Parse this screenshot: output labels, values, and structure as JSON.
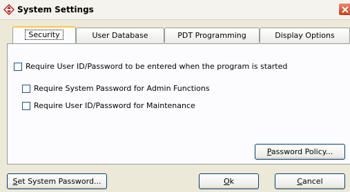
{
  "window": {
    "title": "System Settings",
    "app_icon": "diamond-arrows-icon",
    "close_icon": "close-x-icon",
    "accent_close": "#c4401c"
  },
  "tabs": [
    {
      "label": "Security",
      "active": true
    },
    {
      "label": "User Database",
      "active": false
    },
    {
      "label": "PDT Programming",
      "active": false
    },
    {
      "label": "Display Options",
      "active": false
    }
  ],
  "security": {
    "require_login": {
      "label": "Require User ID/Password to be entered when the program is started",
      "checked": false
    },
    "require_system_password": {
      "label": "Require System Password for Admin Functions",
      "checked": false
    },
    "require_maintenance_login": {
      "label": "Require User ID/Password for Maintenance",
      "checked": false
    },
    "password_policy_button": {
      "mnemonic": "P",
      "rest": "assword Policy..."
    }
  },
  "footer": {
    "set_password": {
      "mnemonic": "S",
      "rest": "et System Password..."
    },
    "ok": {
      "mnemonic": "O",
      "rest": "k"
    },
    "cancel": {
      "mnemonic": "C",
      "rest": "ancel"
    }
  }
}
